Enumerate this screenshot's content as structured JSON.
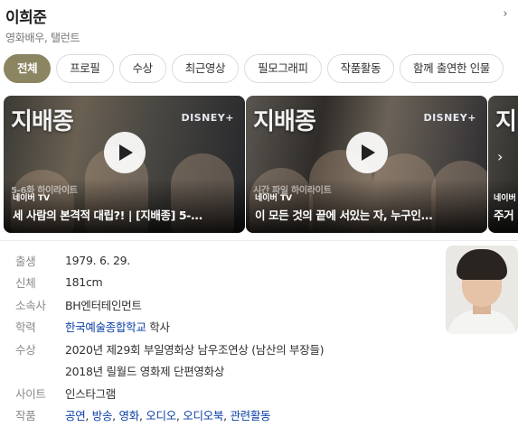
{
  "header": {
    "name": "이희준",
    "subtitle": "영화배우, 탤런트"
  },
  "tabs": [
    {
      "label": "전체",
      "active": true
    },
    {
      "label": "프로필",
      "active": false
    },
    {
      "label": "수상",
      "active": false
    },
    {
      "label": "최근영상",
      "active": false
    },
    {
      "label": "필모그래피",
      "active": false
    },
    {
      "label": "작품활동",
      "active": false
    },
    {
      "label": "함께 출연한 인물",
      "active": false
    }
  ],
  "videos": [
    {
      "show_title": "지배종",
      "brand": "DISNEY+",
      "overlay_text": "5-6화 하이라이트",
      "source": "네이버 TV",
      "title": "세 사람의 본격적 대립?! | [지배종] 5-..."
    },
    {
      "show_title": "지배종",
      "brand": "DISNEY+",
      "overlay_text": "시간 파일 하이라이트",
      "source": "네이버 TV",
      "title": "이 모든 것의 끝에 서있는 자, 누구인..."
    },
    {
      "show_title": "지",
      "brand": "",
      "overlay_text": "",
      "source": "네이버",
      "title": "주거"
    }
  ],
  "profile": {
    "birth": {
      "label": "출생",
      "value": "1979. 6. 29."
    },
    "body": {
      "label": "신체",
      "value": "181cm"
    },
    "agency": {
      "label": "소속사",
      "value": "BH엔터테인먼트"
    },
    "education": {
      "label": "학력",
      "school": "한국예술종합학교",
      "degree": "학사"
    },
    "awards": {
      "label": "수상",
      "items": [
        "2020년 제29회 부일영화상 남우조연상 (남산의 부장들)",
        "2018년 릴월드 영화제 단편영화상"
      ]
    },
    "site": {
      "label": "사이트",
      "value": "인스타그램"
    },
    "works": {
      "label": "작품",
      "items": [
        "공연",
        "방송",
        "영화",
        "오디오",
        "오디오북",
        "관련활동"
      ]
    }
  },
  "icons": {
    "tab_scroll": "chevron-right-icon",
    "play": "play-icon"
  },
  "colors": {
    "active_tab": "#8b8562",
    "link": "#0b3fa8",
    "label_gray": "#888888"
  }
}
